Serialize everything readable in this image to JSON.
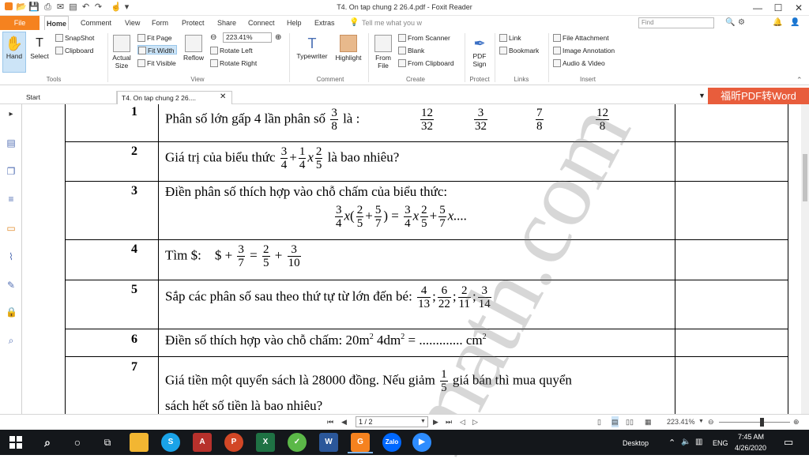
{
  "window": {
    "title": "T4. On tap chung 2 26.4.pdf - Foxit Reader",
    "min": "—",
    "max": "☐",
    "close": "✕"
  },
  "menu": {
    "file": "File",
    "tabs": [
      "Home",
      "Comment",
      "View",
      "Form",
      "Protect",
      "Share",
      "Connect",
      "Help",
      "Extras"
    ],
    "tell_me": "Tell me what you w",
    "find_placeholder": "Find"
  },
  "ribbon": {
    "hand": "Hand",
    "select": "Select",
    "snapshot": "SnapShot",
    "clipboard": "Clipboard",
    "actual_size": "Actual Size",
    "fit_page": "Fit Page",
    "fit_width": "Fit Width",
    "fit_visible": "Fit Visible",
    "reflow": "Reflow",
    "zoom": "223.41%",
    "rotate_left": "Rotate Left",
    "rotate_right": "Rotate Right",
    "typewriter": "Typewriter",
    "highlight": "Highlight",
    "from_file": "From File",
    "from_scanner": "From Scanner",
    "blank": "Blank",
    "from_clipboard": "From Clipboard",
    "pdf_sign": "PDF Sign",
    "link": "Link",
    "bookmark": "Bookmark",
    "file_attachment": "File Attachment",
    "image_annotation": "Image Annotation",
    "audio_video": "Audio & Video",
    "groups": {
      "tools": "Tools",
      "view": "View",
      "comment": "Comment",
      "create": "Create",
      "protect": "Protect",
      "links": "Links",
      "insert": "Insert"
    }
  },
  "tabs": {
    "start": "Start",
    "doc": "T4. On tap chung 2 26....",
    "promo": "福昕PDF转Word"
  },
  "questions": [
    {
      "n": "1",
      "text": "Phân số lớn gấp 4 lần phân số",
      "frac": [
        "3",
        "8"
      ],
      "after": "là :",
      "options": [
        [
          "12",
          "32"
        ],
        [
          "3",
          "32"
        ],
        [
          "7",
          "8"
        ],
        [
          "12",
          "8"
        ]
      ]
    },
    {
      "n": "2",
      "text": "Giá trị của biểu thức",
      "after": "là bao nhiêu?"
    },
    {
      "n": "3",
      "text": "Điền phân số thích hợp vào chỗ chấm của biểu thức:",
      "tail": "x...."
    },
    {
      "n": "4",
      "text": "Tìm $:",
      "dollar": "$ +"
    },
    {
      "n": "5",
      "text": "Sắp các phân số sau theo thứ tự từ lớn đến bé:"
    },
    {
      "n": "6",
      "text": "Điền số thích hợp vào chỗ chấm:  20m",
      "mid": " 4dm",
      "dots": " = ............. cm",
      "sup": "2"
    },
    {
      "n": "7",
      "line1": "Giá tiền một quyển sách là 28000 đồng. Nếu giảm",
      "line1b": "giá bán thì mua quyển",
      "line2": "sách hết số tiền là bao nhiêu?"
    }
  ],
  "fracs": {
    "q2": [
      [
        "3",
        "4"
      ],
      [
        "1",
        "4"
      ],
      [
        "2",
        "5"
      ]
    ],
    "q3_left": [
      [
        "3",
        "4"
      ],
      [
        "2",
        "5"
      ],
      [
        "5",
        "7"
      ]
    ],
    "q3_right": [
      [
        "3",
        "4"
      ],
      [
        "2",
        "5"
      ],
      [
        "5",
        "7"
      ]
    ],
    "q4": [
      [
        "3",
        "7"
      ],
      [
        "2",
        "5"
      ],
      [
        "3",
        "10"
      ]
    ],
    "q5": [
      [
        "4",
        "13"
      ],
      [
        "6",
        "22"
      ],
      [
        "2",
        "11"
      ],
      [
        "3",
        "14"
      ]
    ],
    "q7": [
      "1",
      "5"
    ]
  },
  "watermark": "math.com",
  "status": {
    "page": "1 / 2",
    "zoom": "223.41%"
  },
  "taskbar": {
    "desktop": "Desktop",
    "lang": "ENG",
    "time": "7:45 AM",
    "date": "4/26/2020"
  }
}
